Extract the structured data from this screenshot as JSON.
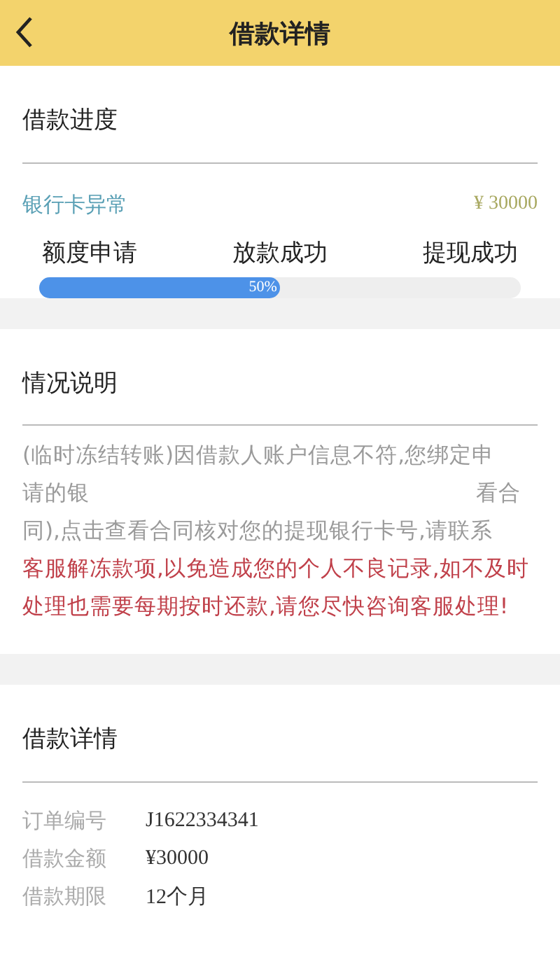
{
  "header": {
    "title": "借款详情"
  },
  "progress": {
    "title": "借款进度",
    "status": "银行卡异常",
    "amount": "¥ 30000",
    "steps": [
      "额度申请",
      "放款成功",
      "提现成功"
    ],
    "bar": {
      "level": 0.5,
      "reading": "50%"
    }
  },
  "notice": {
    "title": "情况说明",
    "lines": [
      {
        "kind": "full",
        "parts": [
          "(临时冻结转账)因借款人账户信息不符,您绑定申"
        ]
      },
      {
        "kind": "split",
        "parts": [
          "请的银",
          "看合"
        ]
      },
      {
        "kind": "full",
        "parts": [
          "同),点击查看合同核对您的提现银行卡号,请联系"
        ]
      }
    ],
    "warning": "客服解冻款项,以免造成您的个人不良记录,如不及时处理也需要每期按时还款,请您尽快咨询客服处理!"
  },
  "details": {
    "title": "借款详情",
    "rows": [
      {
        "label": "订单编号",
        "value": "J1622334341"
      },
      {
        "label": "借款金额",
        "value": "¥30000"
      },
      {
        "label": "借款期限",
        "value": "12个月"
      }
    ]
  }
}
